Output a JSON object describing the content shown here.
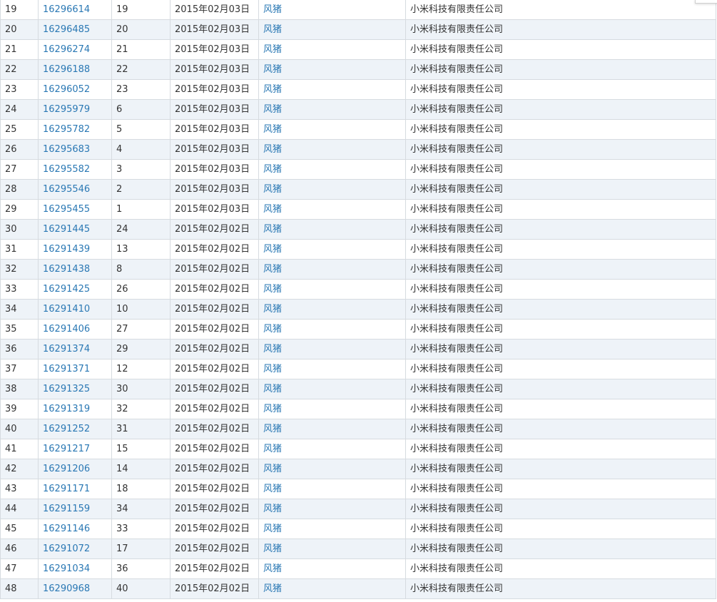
{
  "rows": [
    {
      "rank": "19",
      "id": "16296614",
      "num": "19",
      "date": "2015年02月03日",
      "user": "风猪",
      "company": "小米科技有限责任公司"
    },
    {
      "rank": "20",
      "id": "16296485",
      "num": "20",
      "date": "2015年02月03日",
      "user": "风猪",
      "company": "小米科技有限责任公司"
    },
    {
      "rank": "21",
      "id": "16296274",
      "num": "21",
      "date": "2015年02月03日",
      "user": "风猪",
      "company": "小米科技有限责任公司"
    },
    {
      "rank": "22",
      "id": "16296188",
      "num": "22",
      "date": "2015年02月03日",
      "user": "风猪",
      "company": "小米科技有限责任公司"
    },
    {
      "rank": "23",
      "id": "16296052",
      "num": "23",
      "date": "2015年02月03日",
      "user": "风猪",
      "company": "小米科技有限责任公司"
    },
    {
      "rank": "24",
      "id": "16295979",
      "num": "6",
      "date": "2015年02月03日",
      "user": "风猪",
      "company": "小米科技有限责任公司"
    },
    {
      "rank": "25",
      "id": "16295782",
      "num": "5",
      "date": "2015年02月03日",
      "user": "风猪",
      "company": "小米科技有限责任公司"
    },
    {
      "rank": "26",
      "id": "16295683",
      "num": "4",
      "date": "2015年02月03日",
      "user": "风猪",
      "company": "小米科技有限责任公司"
    },
    {
      "rank": "27",
      "id": "16295582",
      "num": "3",
      "date": "2015年02月03日",
      "user": "风猪",
      "company": "小米科技有限责任公司"
    },
    {
      "rank": "28",
      "id": "16295546",
      "num": "2",
      "date": "2015年02月03日",
      "user": "风猪",
      "company": "小米科技有限责任公司"
    },
    {
      "rank": "29",
      "id": "16295455",
      "num": "1",
      "date": "2015年02月03日",
      "user": "风猪",
      "company": "小米科技有限责任公司"
    },
    {
      "rank": "30",
      "id": "16291445",
      "num": "24",
      "date": "2015年02月02日",
      "user": "风猪",
      "company": "小米科技有限责任公司"
    },
    {
      "rank": "31",
      "id": "16291439",
      "num": "13",
      "date": "2015年02月02日",
      "user": "风猪",
      "company": "小米科技有限责任公司"
    },
    {
      "rank": "32",
      "id": "16291438",
      "num": "8",
      "date": "2015年02月02日",
      "user": "风猪",
      "company": "小米科技有限责任公司"
    },
    {
      "rank": "33",
      "id": "16291425",
      "num": "26",
      "date": "2015年02月02日",
      "user": "风猪",
      "company": "小米科技有限责任公司"
    },
    {
      "rank": "34",
      "id": "16291410",
      "num": "10",
      "date": "2015年02月02日",
      "user": "风猪",
      "company": "小米科技有限责任公司"
    },
    {
      "rank": "35",
      "id": "16291406",
      "num": "27",
      "date": "2015年02月02日",
      "user": "风猪",
      "company": "小米科技有限责任公司"
    },
    {
      "rank": "36",
      "id": "16291374",
      "num": "29",
      "date": "2015年02月02日",
      "user": "风猪",
      "company": "小米科技有限责任公司"
    },
    {
      "rank": "37",
      "id": "16291371",
      "num": "12",
      "date": "2015年02月02日",
      "user": "风猪",
      "company": "小米科技有限责任公司"
    },
    {
      "rank": "38",
      "id": "16291325",
      "num": "30",
      "date": "2015年02月02日",
      "user": "风猪",
      "company": "小米科技有限责任公司"
    },
    {
      "rank": "39",
      "id": "16291319",
      "num": "32",
      "date": "2015年02月02日",
      "user": "风猪",
      "company": "小米科技有限责任公司"
    },
    {
      "rank": "40",
      "id": "16291252",
      "num": "31",
      "date": "2015年02月02日",
      "user": "风猪",
      "company": "小米科技有限责任公司"
    },
    {
      "rank": "41",
      "id": "16291217",
      "num": "15",
      "date": "2015年02月02日",
      "user": "风猪",
      "company": "小米科技有限责任公司"
    },
    {
      "rank": "42",
      "id": "16291206",
      "num": "14",
      "date": "2015年02月02日",
      "user": "风猪",
      "company": "小米科技有限责任公司"
    },
    {
      "rank": "43",
      "id": "16291171",
      "num": "18",
      "date": "2015年02月02日",
      "user": "风猪",
      "company": "小米科技有限责任公司"
    },
    {
      "rank": "44",
      "id": "16291159",
      "num": "34",
      "date": "2015年02月02日",
      "user": "风猪",
      "company": "小米科技有限责任公司"
    },
    {
      "rank": "45",
      "id": "16291146",
      "num": "33",
      "date": "2015年02月02日",
      "user": "风猪",
      "company": "小米科技有限责任公司"
    },
    {
      "rank": "46",
      "id": "16291072",
      "num": "17",
      "date": "2015年02月02日",
      "user": "风猪",
      "company": "小米科技有限责任公司"
    },
    {
      "rank": "47",
      "id": "16291034",
      "num": "36",
      "date": "2015年02月02日",
      "user": "风猪",
      "company": "小米科技有限责任公司"
    },
    {
      "rank": "48",
      "id": "16290968",
      "num": "40",
      "date": "2015年02月02日",
      "user": "风猪",
      "company": "小米科技有限责任公司"
    }
  ],
  "colors": {
    "link": "#2a78b4",
    "row_alt": "#eef3f8",
    "border": "#d6dbe0",
    "text": "#333333"
  }
}
